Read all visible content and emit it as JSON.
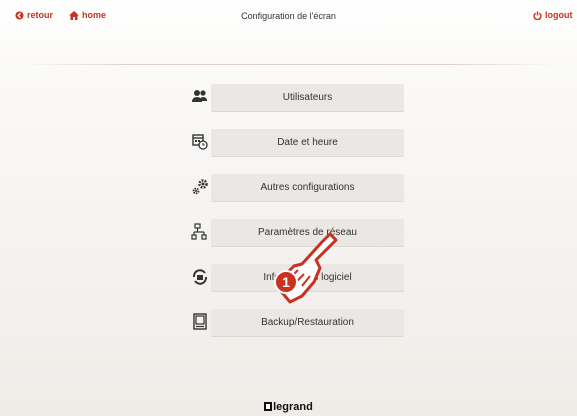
{
  "header": {
    "back_label": "retour",
    "home_label": "home",
    "title": "Configuration de l'écran",
    "logout_label": "logout"
  },
  "menu": [
    {
      "label": "Utilisateurs",
      "icon": "users-icon"
    },
    {
      "label": "Date et heure",
      "icon": "calendar-clock-icon"
    },
    {
      "label": "Autres configurations",
      "icon": "gears-icon"
    },
    {
      "label": "Paramètres de réseau",
      "icon": "network-icon"
    },
    {
      "label": "Informations logiciel",
      "icon": "software-info-icon"
    },
    {
      "label": "Backup/Restauration",
      "icon": "backup-icon"
    }
  ],
  "callout": {
    "number": "1"
  },
  "footer": {
    "brand": "legrand"
  },
  "colors": {
    "accent": "#c8321e",
    "button": "#ebe7e4",
    "icon": "#333333"
  }
}
